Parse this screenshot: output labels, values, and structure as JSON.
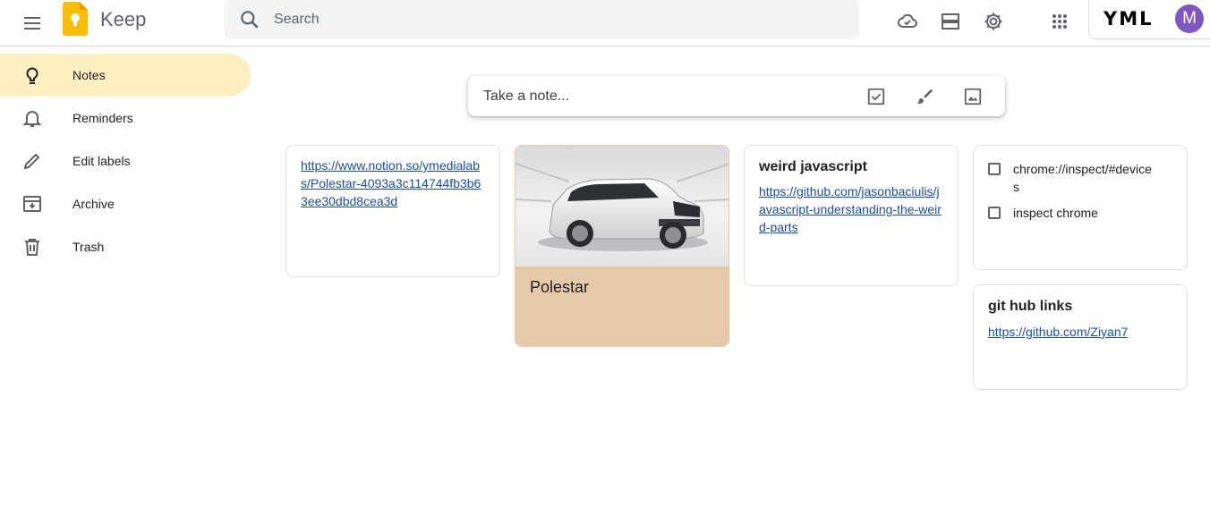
{
  "header": {
    "app_title": "Keep",
    "search_placeholder": "Search",
    "org_badge": "YML",
    "avatar_initial": "M"
  },
  "sidebar": {
    "items": [
      {
        "label": "Notes",
        "icon": "lightbulb-icon",
        "active": true
      },
      {
        "label": "Reminders",
        "icon": "bell-icon"
      },
      {
        "label": "Edit labels",
        "icon": "pencil-icon"
      },
      {
        "label": "Archive",
        "icon": "archive-icon"
      },
      {
        "label": "Trash",
        "icon": "trash-icon"
      }
    ]
  },
  "take_note": {
    "placeholder": "Take a note..."
  },
  "notes": {
    "notion": {
      "link": "https://www.notion.so/ymedialabs/Polestar-4093a3c114744fb3b63ee30dbd8cea3d"
    },
    "polestar": {
      "title": "Polestar",
      "color": "#e6c9a8"
    },
    "weird_js": {
      "title": "weird javascript",
      "link": "https://github.com/jasonbaciulis/javascript-understanding-the-weird-parts"
    },
    "checklist": {
      "items": [
        "chrome://inspect/#devices",
        "inspect chrome"
      ]
    },
    "github": {
      "title": "git hub links",
      "link": "https://github.com/Ziyan7"
    }
  },
  "colors": {
    "accent": "#feefc3",
    "link": "#1a4fa0",
    "avatar": "#7e57c2",
    "logo": "#fbbc04"
  }
}
